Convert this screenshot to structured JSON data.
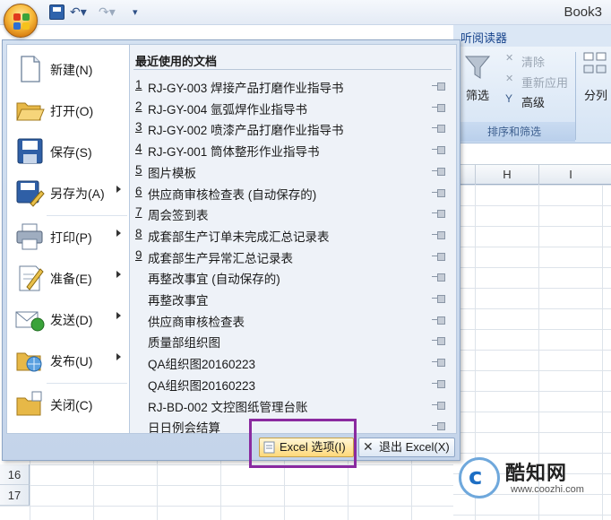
{
  "window": {
    "title": "Book3"
  },
  "qat": {
    "save_icon": "save-icon",
    "undo_icon": "undo-icon",
    "redo_icon": "redo-icon",
    "customize_icon": "customize-icon"
  },
  "ribbon": {
    "tab_label": "听阅读器",
    "filter_label": "筛选",
    "clear_label": "清除",
    "reapply_label": "重新应用",
    "advanced_label": "高级",
    "split_label": "分列",
    "group_label": "排序和筛选"
  },
  "sheet": {
    "columns": [
      "H",
      "I"
    ],
    "rows": [
      "16",
      "17"
    ]
  },
  "menu": {
    "commands": [
      {
        "label": "新建(N)",
        "icon": "new-document-icon",
        "has_submenu": false
      },
      {
        "label": "打开(O)",
        "icon": "open-folder-icon",
        "has_submenu": false
      },
      {
        "label": "保存(S)",
        "icon": "save-disk-icon",
        "has_submenu": false
      },
      {
        "label": "另存为(A)",
        "icon": "save-as-icon",
        "has_submenu": true
      },
      {
        "label": "打印(P)",
        "icon": "printer-icon",
        "has_submenu": true
      },
      {
        "label": "准备(E)",
        "icon": "prepare-icon",
        "has_submenu": true
      },
      {
        "label": "发送(D)",
        "icon": "send-icon",
        "has_submenu": true
      },
      {
        "label": "发布(U)",
        "icon": "publish-icon",
        "has_submenu": true
      },
      {
        "label": "关闭(C)",
        "icon": "close-folder-icon",
        "has_submenu": false
      }
    ],
    "recent_title": "最近使用的文档",
    "recent_docs": [
      {
        "num": "1",
        "name": "RJ-GY-003 焊接产品打磨作业指导书"
      },
      {
        "num": "2",
        "name": "RJ-GY-004 氩弧焊作业指导书"
      },
      {
        "num": "3",
        "name": "RJ-GY-002 喷漆产品打磨作业指导书"
      },
      {
        "num": "4",
        "name": "RJ-GY-001 筒体整形作业指导书"
      },
      {
        "num": "5",
        "name": "图片模板"
      },
      {
        "num": "6",
        "name": "供应商审核检查表 (自动保存的)"
      },
      {
        "num": "7",
        "name": "周会签到表"
      },
      {
        "num": "8",
        "name": "成套部生产订单未完成汇总记录表"
      },
      {
        "num": "9",
        "name": "成套部生产异常汇总记录表"
      },
      {
        "num": "",
        "name": "再整改事宜 (自动保存的)"
      },
      {
        "num": "",
        "name": "再整改事宜"
      },
      {
        "num": "",
        "name": "供应商审核检查表"
      },
      {
        "num": "",
        "name": "质量部组织图"
      },
      {
        "num": "",
        "name": "QA组织图20160223"
      },
      {
        "num": "",
        "name": "QA组织图20160223"
      },
      {
        "num": "",
        "name": "RJ-BD-002 文控图纸管理台账"
      },
      {
        "num": "",
        "name": "日日例会结算"
      }
    ],
    "options_button": "Excel 选项(I)",
    "exit_button": "退出 Excel(X)"
  },
  "watermark": {
    "title": "酷知网",
    "url": "www.coozhi.com"
  },
  "colors": {
    "accent": "#15428b",
    "highlight_box": "#8a2aa0",
    "menu_bg": "#c9d8ec"
  }
}
